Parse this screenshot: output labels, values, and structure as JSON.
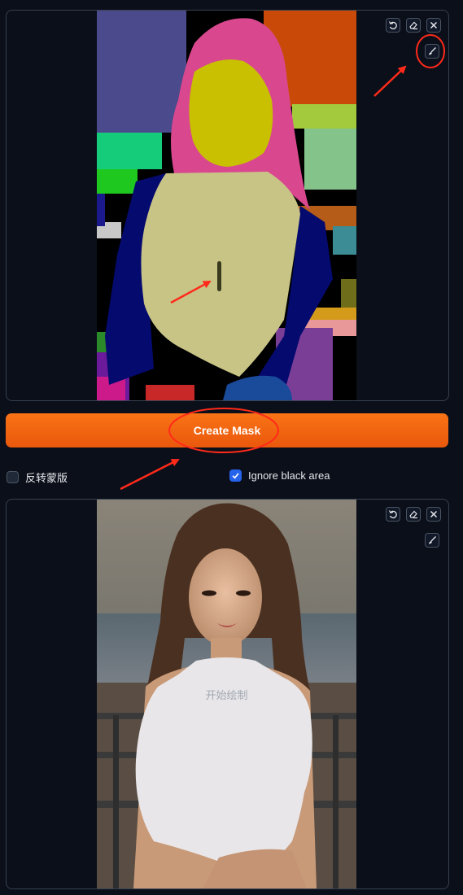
{
  "mask_panel": {
    "toolbar": {
      "undo_icon": "undo-icon",
      "erase_icon": "eraser-icon",
      "close_icon": "close-icon",
      "brush_icon": "brush-icon"
    }
  },
  "create_mask": {
    "label": "Create Mask"
  },
  "options": {
    "invert_mask": {
      "label": "反转蒙版",
      "checked": false
    },
    "ignore_black": {
      "label": "Ignore black area",
      "checked": true
    }
  },
  "photo_panel": {
    "overlay_text": "开始绘制",
    "toolbar": {
      "undo_icon": "undo-icon",
      "erase_icon": "eraser-icon",
      "close_icon": "close-icon",
      "brush_icon": "brush-icon"
    }
  },
  "colors": {
    "accent": "#f97316",
    "annotation": "#ff2a1a",
    "checkbox_on": "#2563eb",
    "background": "#0b0f19"
  }
}
